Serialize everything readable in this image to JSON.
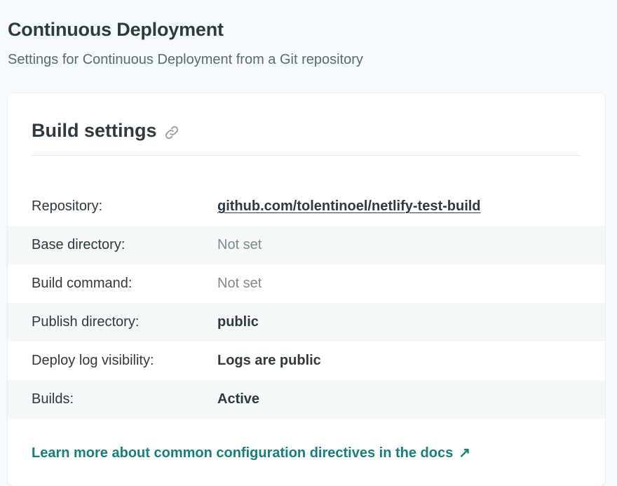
{
  "page": {
    "title": "Continuous Deployment",
    "subtitle": "Settings for Continuous Deployment from a Git repository"
  },
  "card": {
    "title": "Build settings",
    "title_icon": "link-icon",
    "rows": [
      {
        "label": "Repository:",
        "value": "github.com/tolentinoel/netlify-test-build",
        "style": "link"
      },
      {
        "label": "Base directory:",
        "value": "Not set",
        "style": "muted"
      },
      {
        "label": "Build command:",
        "value": "Not set",
        "style": "muted"
      },
      {
        "label": "Publish directory:",
        "value": "public",
        "style": "bold"
      },
      {
        "label": "Deploy log visibility:",
        "value": "Logs are public",
        "style": "bold"
      },
      {
        "label": "Builds:",
        "value": "Active",
        "style": "bold"
      }
    ],
    "docs_link": {
      "label": "Learn more about common configuration directives in the docs",
      "icon": "external-arrow-icon",
      "arrow": "↗"
    }
  },
  "colors": {
    "page_background": "#f5fbfd",
    "accent": "#147f7c",
    "muted_text": "#7d8a90",
    "stripe": "#f5f8f9"
  }
}
